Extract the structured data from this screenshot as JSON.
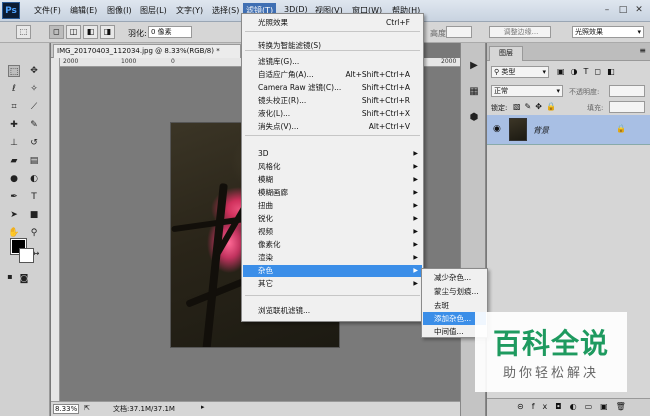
{
  "app": {
    "logo": "Ps"
  },
  "menubar": {
    "items": [
      "文件(F)",
      "编辑(E)",
      "图像(I)",
      "图层(L)",
      "文字(Y)",
      "选择(S)",
      "滤镜(T)",
      "3D(D)",
      "视图(V)",
      "窗口(W)",
      "帮助(H)"
    ],
    "active_index": 6
  },
  "options_bar": {
    "feather_label": "羽化:",
    "feather_value": "0 像素",
    "adjust_edge": "调整边缘...",
    "workspace": "光照效果",
    "height_label": "高度:"
  },
  "document": {
    "tab_title": "IMG_20170403_112034.jpg @ 8.33%(RGB/8) *",
    "ruler_labels": [
      "2000",
      "1000",
      "0",
      "1000",
      "2000"
    ],
    "zoom": "8.33%",
    "doc_info": "文档:37.1M/37.1M"
  },
  "filter_menu": {
    "items": [
      {
        "label": "光照效果",
        "shortcut": "Ctrl+F"
      },
      {
        "label": "转换为智能滤镜(S)"
      },
      {
        "label": "滤镜库(G)..."
      },
      {
        "label": "自适应广角(A)...",
        "shortcut": "Alt+Shift+Ctrl+A"
      },
      {
        "label": "Camera Raw 滤镜(C)...",
        "shortcut": "Shift+Ctrl+A"
      },
      {
        "label": "镜头校正(R)...",
        "shortcut": "Shift+Ctrl+R"
      },
      {
        "label": "液化(L)...",
        "shortcut": "Shift+Ctrl+X"
      },
      {
        "label": "消失点(V)...",
        "shortcut": "Alt+Ctrl+V"
      },
      {
        "label": "3D",
        "submenu": true
      },
      {
        "label": "风格化",
        "submenu": true
      },
      {
        "label": "模糊",
        "submenu": true
      },
      {
        "label": "模糊画廊",
        "submenu": true
      },
      {
        "label": "扭曲",
        "submenu": true
      },
      {
        "label": "锐化",
        "submenu": true
      },
      {
        "label": "视频",
        "submenu": true
      },
      {
        "label": "像素化",
        "submenu": true
      },
      {
        "label": "渲染",
        "submenu": true
      },
      {
        "label": "杂色",
        "submenu": true,
        "highlighted": true
      },
      {
        "label": "其它",
        "submenu": true
      },
      {
        "label": "浏览联机滤镜..."
      }
    ]
  },
  "noise_submenu": {
    "items": [
      "减少杂色...",
      "蒙尘与划痕...",
      "去斑",
      "添加杂色...",
      "中间值..."
    ],
    "highlighted_index": 3
  },
  "layers_panel": {
    "tab": "图层",
    "kind_filter": "类型",
    "blend_mode": "正常",
    "opacity_label": "不透明度:",
    "lock_label": "锁定:",
    "fill_label": "填充:",
    "layer_name": "背景"
  },
  "watermark": {
    "title": "百科全说",
    "subtitle": "助你轻松解决"
  },
  "colors": {
    "highlight": "#3b8ee8",
    "layer_selected": "#a8bfe4",
    "watermark_green": "#1e9a5f"
  }
}
